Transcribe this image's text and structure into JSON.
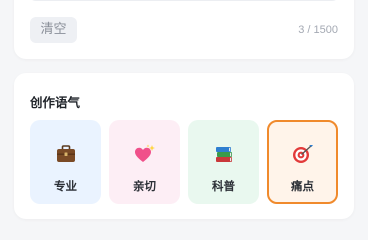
{
  "editor": {
    "clear_label": "清空",
    "counter": "3 / 1500"
  },
  "tone_section": {
    "title": "创作语气",
    "options": [
      {
        "label": "专业",
        "icon": "briefcase-icon",
        "selected": false
      },
      {
        "label": "亲切",
        "icon": "sparkling-heart-icon",
        "selected": false
      },
      {
        "label": "科普",
        "icon": "books-icon",
        "selected": false
      },
      {
        "label": "痛点",
        "icon": "bullseye-icon",
        "selected": true
      }
    ]
  },
  "colors": {
    "selected_border": "#f08a2c",
    "pro_bg": "#eaf3ff",
    "warm_bg": "#fdeef5",
    "sci_bg": "#e9f8ef",
    "pain_bg": "#fff4ea"
  }
}
